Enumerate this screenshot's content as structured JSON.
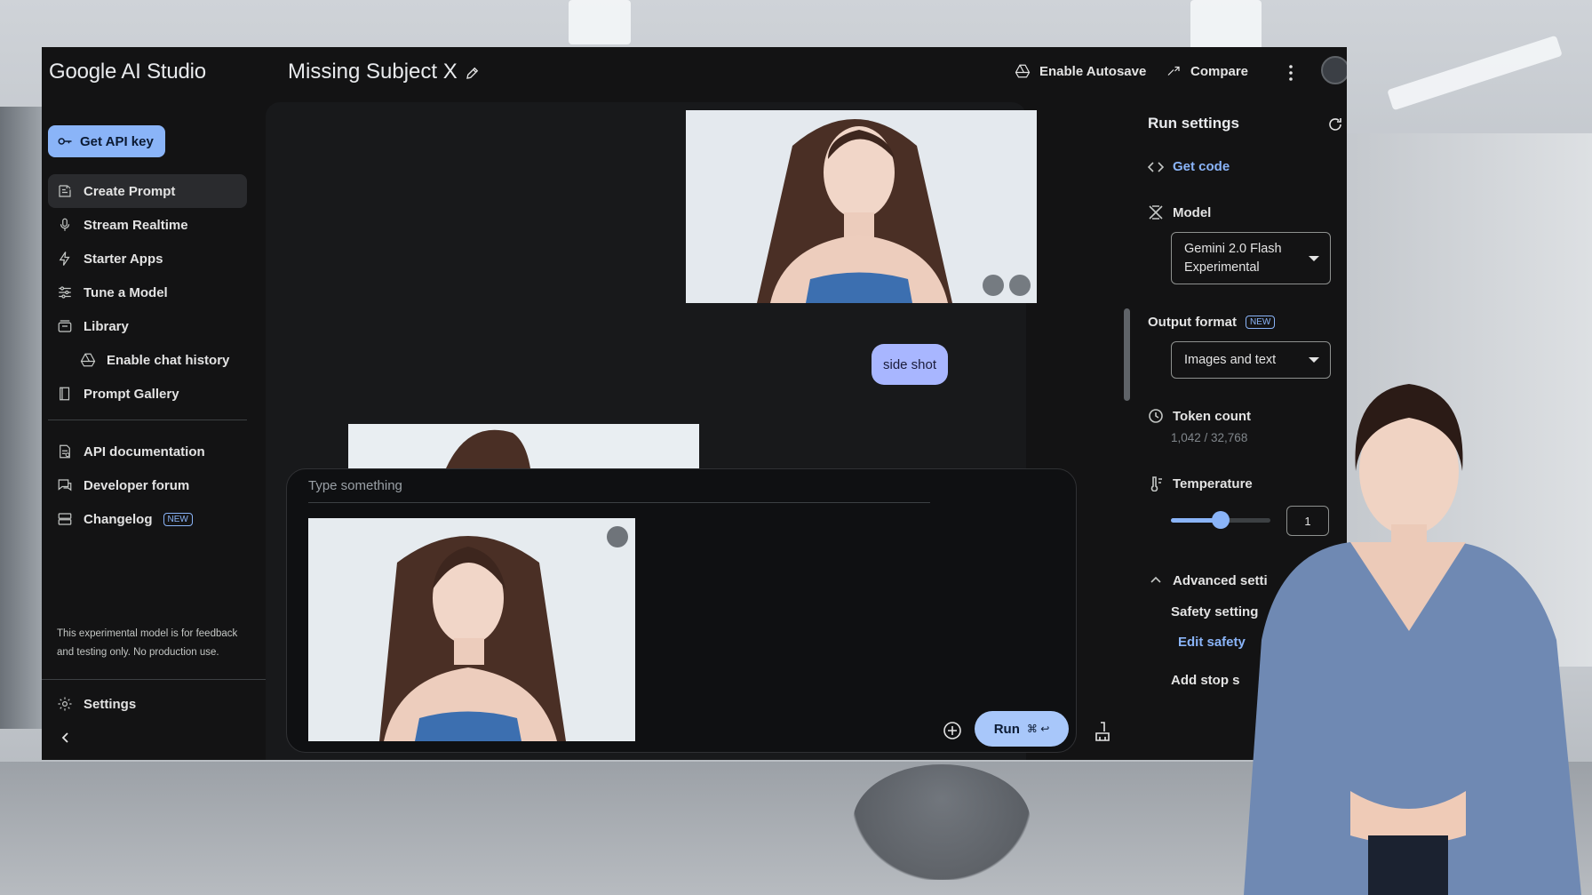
{
  "app": {
    "brand": "Google AI Studio",
    "doc_title": "Missing Subject X",
    "enable_autosave": "Enable Autosave",
    "compare": "Compare"
  },
  "sidebar": {
    "api_key_label": "Get API key",
    "items": [
      {
        "label": "Create Prompt",
        "icon": "create-prompt-icon",
        "active": true
      },
      {
        "label": "Stream Realtime",
        "icon": "mic-icon"
      },
      {
        "label": "Starter Apps",
        "icon": "bolt-icon"
      },
      {
        "label": "Tune a Model",
        "icon": "tune-icon"
      },
      {
        "label": "Library",
        "icon": "library-icon"
      },
      {
        "label": "Enable chat history",
        "icon": "drive-icon"
      },
      {
        "label": "Prompt Gallery",
        "icon": "book-icon"
      },
      {
        "label": "API documentation",
        "icon": "doc-icon"
      },
      {
        "label": "Developer forum",
        "icon": "forum-icon"
      },
      {
        "label": "Changelog",
        "icon": "changelog-icon",
        "badge": "NEW"
      }
    ],
    "disclaimer": "This experimental model is for feedback and testing only. No production use.",
    "settings_label": "Settings"
  },
  "chat": {
    "user_message": "side shot",
    "input_placeholder": "Type something",
    "run_label": "Run",
    "run_shortcut": "⌘ ↩"
  },
  "run_settings": {
    "title": "Run settings",
    "get_code": "Get code",
    "model_label": "Model",
    "model_value": "Gemini 2.0 Flash Experimental",
    "output_format_label": "Output format",
    "output_format_badge": "NEW",
    "output_format_value": "Images and text",
    "token_count_label": "Token count",
    "token_count_value": "1,042 / 32,768",
    "temperature_label": "Temperature",
    "temperature_value": "1",
    "temperature_fraction": 0.5,
    "advanced_settings": "Advanced setti",
    "safety_settings": "Safety setting",
    "edit_safety": "Edit safety",
    "add_stop": "Add stop s"
  },
  "colors": {
    "accent": "#8ab4f8",
    "user_bubble": "#a8b6ff",
    "app_bg": "#131314"
  }
}
